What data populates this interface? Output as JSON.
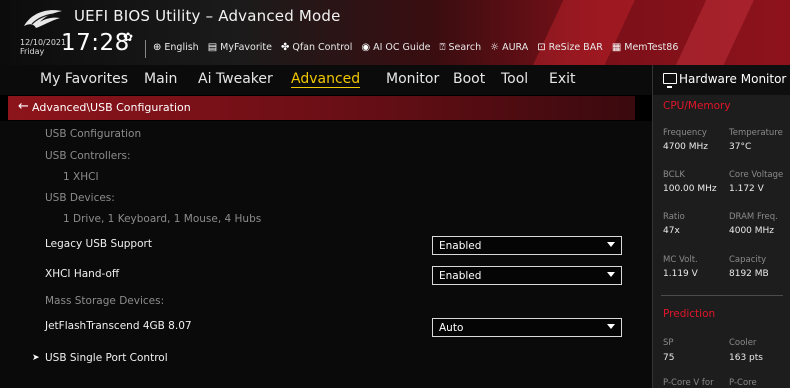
{
  "header": {
    "app_title": "UEFI BIOS Utility – Advanced Mode",
    "date": "12/10/2021",
    "day": "Friday",
    "time": "17:28",
    "toolbar": [
      {
        "icon": "globe-icon",
        "label": "English"
      },
      {
        "icon": "favorites-icon",
        "label": "MyFavorite"
      },
      {
        "icon": "fan-icon",
        "label": "Qfan Control"
      },
      {
        "icon": "ai-oc-icon",
        "label": "AI OC Guide"
      },
      {
        "icon": "search-icon",
        "label": "Search"
      },
      {
        "icon": "aura-icon",
        "label": "AURA"
      },
      {
        "icon": "resize-bar-icon",
        "label": "ReSize BAR"
      },
      {
        "icon": "memtest-icon",
        "label": "MemTest86"
      }
    ]
  },
  "nav": {
    "tabs": [
      "My Favorites",
      "Main",
      "Ai Tweaker",
      "Advanced",
      "Monitor",
      "Boot",
      "Tool",
      "Exit"
    ],
    "active": "Advanced"
  },
  "path": "Advanced\\USB Configuration",
  "content": {
    "usb_configuration": "USB Configuration",
    "usb_controllers": "USB Controllers:",
    "controllers_value": "1 XHCI",
    "usb_devices": "USB Devices:",
    "devices_value": "1 Drive, 1 Keyboard, 1 Mouse, 4 Hubs",
    "legacy_label": "Legacy USB Support",
    "legacy_value": "Enabled",
    "xhci_label": "XHCI Hand-off",
    "xhci_value": "Enabled",
    "mass_storage": "Mass Storage Devices:",
    "jetflash_label": "JetFlashTranscend 4GB 8.07",
    "jetflash_value": "Auto",
    "single_port": "USB Single Port Control"
  },
  "hardware_monitor": {
    "title": "Hardware Monitor",
    "cpu_section": "CPU/Memory",
    "frequency_label": "Frequency",
    "frequency_value": "4700 MHz",
    "temperature_label": "Temperature",
    "temperature_value": "37°C",
    "bclk_label": "BCLK",
    "bclk_value": "100.00 MHz",
    "core_voltage_label": "Core Voltage",
    "core_voltage_value": "1.172 V",
    "ratio_label": "Ratio",
    "ratio_value": "47x",
    "dram_label": "DRAM Freq.",
    "dram_value": "4000 MHz",
    "mc_label": "MC Volt.",
    "mc_value": "1.119 V",
    "capacity_label": "Capacity",
    "capacity_value": "8192 MB",
    "prediction_section": "Prediction",
    "sp_label": "SP",
    "sp_value": "75",
    "cooler_label": "Cooler",
    "cooler_value": "163 pts",
    "pcore_v_label": "P-Core V for",
    "pcore_label": "P-Core"
  },
  "colors": {
    "accent_red": "#e1152a",
    "active_tab": "#f0c800"
  }
}
